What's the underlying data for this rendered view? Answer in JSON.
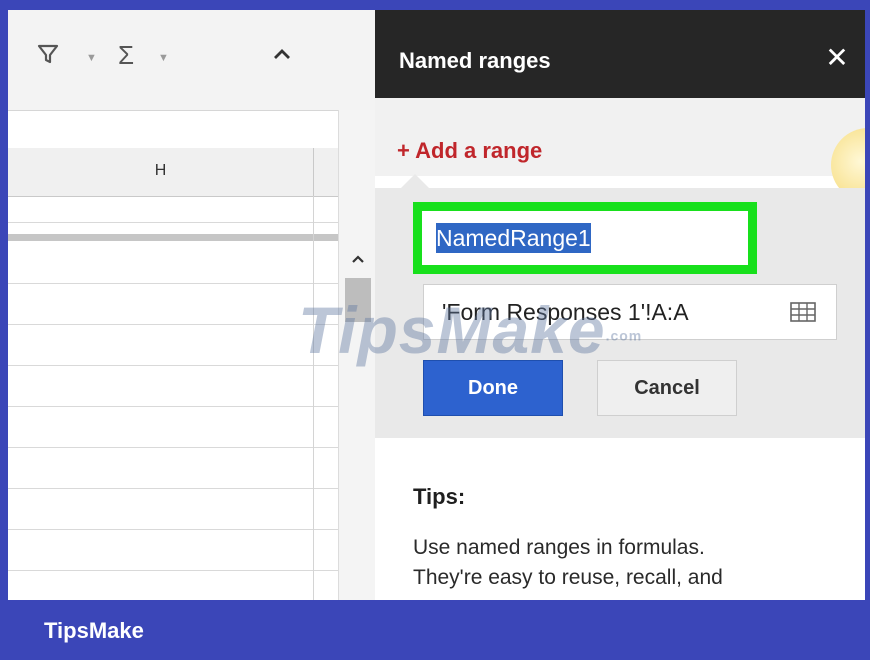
{
  "toolbar": {
    "filter_icon": "filter-icon",
    "sum_icon": "sigma-icon",
    "collapse_icon": "chevron-up-icon"
  },
  "sheet": {
    "column_label": "H"
  },
  "panel": {
    "title": "Named ranges",
    "close_icon": "close-icon",
    "add_range_label": "+ Add a range",
    "name_value": "NamedRange1",
    "range_value": "'Form Responses 1'!A:A",
    "range_picker_icon": "grid-icon",
    "done_label": "Done",
    "cancel_label": "Cancel",
    "tips_title": "Tips:",
    "tips_line1": "Use named ranges in formulas.",
    "tips_line2": "They're easy to reuse, recall, and"
  },
  "watermark": {
    "text": "TipsMake",
    "suffix": ".com"
  },
  "footer": {
    "brand": "TipsMake"
  },
  "colors": {
    "panel_header": "#262626",
    "add_link": "#c0262b",
    "highlight": "#18e01c",
    "done_button": "#2d62cf",
    "frame_border": "#3b46b8"
  }
}
